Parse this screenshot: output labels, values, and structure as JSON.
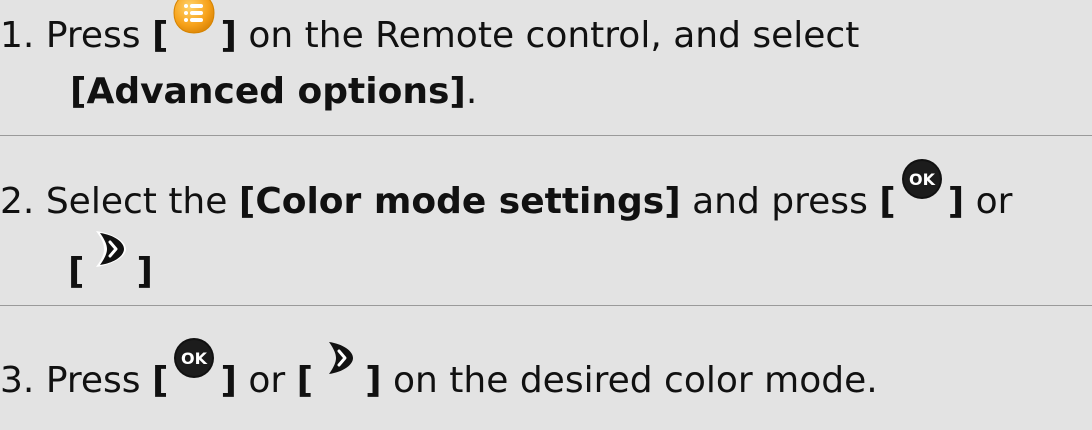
{
  "steps": [
    {
      "number": "1.",
      "pre": "Press",
      "open_bracket": "[",
      "icon": "menu-options-icon",
      "close_bracket": "]",
      "mid": "on the Remote control, and select",
      "bold_term": "[Advanced options]",
      "end": "."
    },
    {
      "number": "2.",
      "pre": "Select the",
      "bold_term": "[Color mode settings]",
      "mid": "and press",
      "open_bracket": "[",
      "icon_ok": "ok-button-icon",
      "close_bracket": "]",
      "or": "or",
      "open_bracket_2": "[",
      "icon_right": "right-arrow-button-icon",
      "close_bracket_2": "]"
    },
    {
      "number": "3.",
      "pre": "Press",
      "open_bracket": "[",
      "icon_ok": "ok-button-icon",
      "close_bracket": "]",
      "or": "or",
      "open_bracket_2": "[",
      "icon_right": "right-arrow-button-icon",
      "close_bracket_2": "]",
      "end": "on the desired color mode."
    }
  ],
  "colors": {
    "background": "#e3e3e3",
    "divider": "#9a9a9a",
    "menu_icon": "#f7a21b",
    "ok_icon": "#111111"
  }
}
